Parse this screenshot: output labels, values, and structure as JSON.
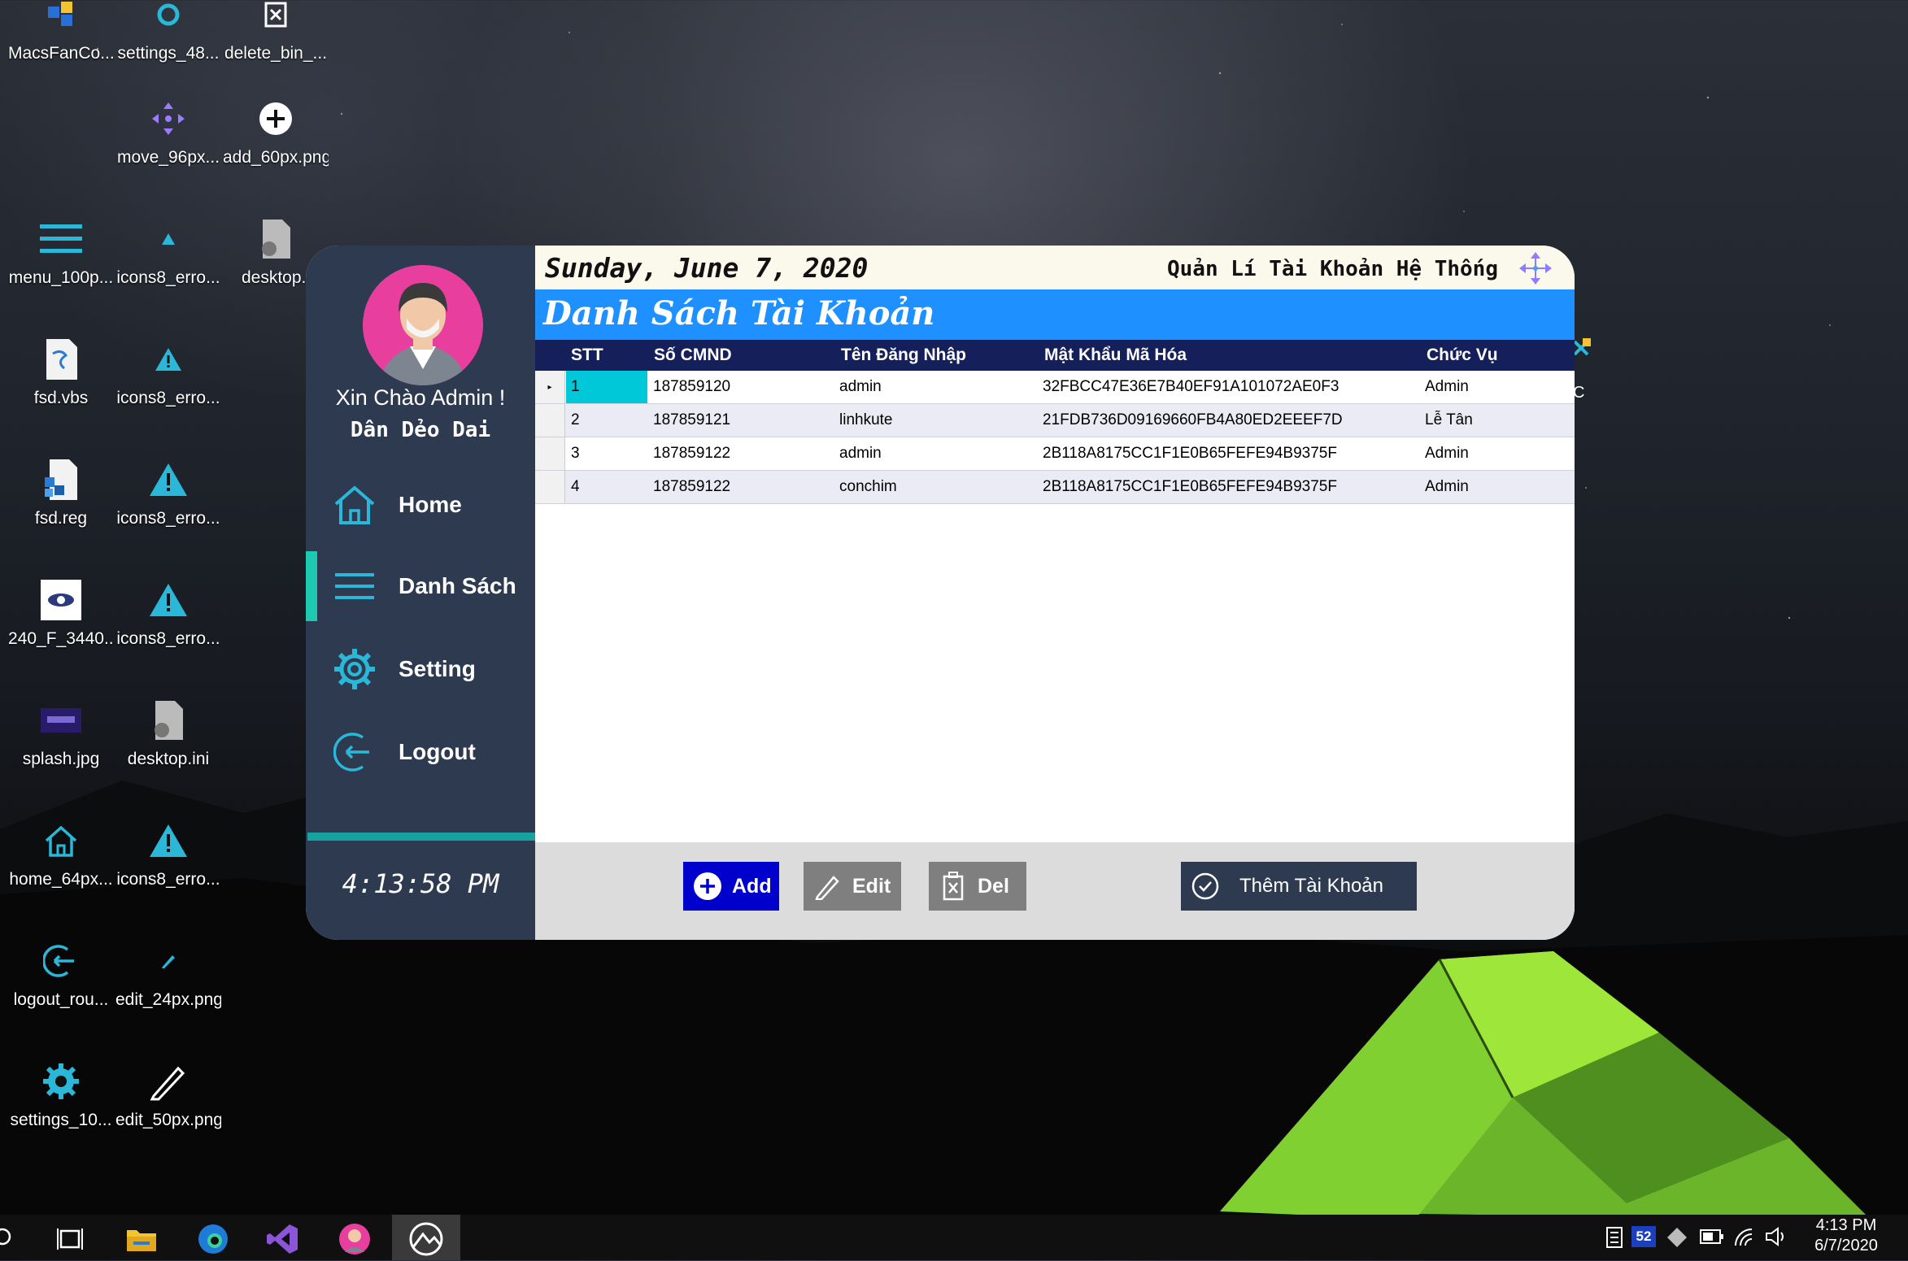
{
  "desktop": {
    "icons": [
      {
        "label": "MacsFanCo...",
        "icon": "app-icon"
      },
      {
        "label": "settings_48...",
        "icon": "gear-icon"
      },
      {
        "label": "delete_bin_...",
        "icon": "delete-icon"
      },
      {
        "label": "move_96px...",
        "icon": "move-icon"
      },
      {
        "label": "add_60px.png",
        "icon": "add-icon"
      },
      {
        "label": "menu_100p...",
        "icon": "menu-icon"
      },
      {
        "label": "icons8_erro...",
        "icon": "warning-icon"
      },
      {
        "label": "desktop.i",
        "icon": "file-gear-icon"
      },
      {
        "label": "fsd.vbs",
        "icon": "script-icon"
      },
      {
        "label": "icons8_erro...",
        "icon": "warning-icon"
      },
      {
        "label": "fsd.reg",
        "icon": "registry-icon"
      },
      {
        "label": "icons8_erro...",
        "icon": "warning-icon"
      },
      {
        "label": "240_F_3440...",
        "icon": "eye-icon"
      },
      {
        "label": "icons8_erro...",
        "icon": "warning-icon"
      },
      {
        "label": "splash.jpg",
        "icon": "image-icon"
      },
      {
        "label": "desktop.ini",
        "icon": "file-gear-icon"
      },
      {
        "label": "home_64px...",
        "icon": "home-icon"
      },
      {
        "label": "icons8_erro...",
        "icon": "warning-icon"
      },
      {
        "label": "logout_rou...",
        "icon": "logout-icon"
      },
      {
        "label": "edit_24px.png",
        "icon": "pencil-icon"
      },
      {
        "label": "settings_10...",
        "icon": "gear-icon"
      },
      {
        "label": "edit_50px.png",
        "icon": "pencil-icon"
      }
    ],
    "right_edge_label": "C"
  },
  "sidebar": {
    "greeting": "Xin Chào Admin !",
    "user_name": "Dân Dẻo Dai",
    "nav": [
      {
        "label": "Home",
        "icon": "home-icon"
      },
      {
        "label": "Danh Sách",
        "icon": "menu-icon",
        "active": true
      },
      {
        "label": "Setting",
        "icon": "gear-icon"
      },
      {
        "label": "Logout",
        "icon": "logout-icon"
      }
    ],
    "clock": "4:13:58 PM"
  },
  "header": {
    "date": "Sunday, June 7, 2020",
    "title": "Quản Lí Tài Khoản Hệ Thống"
  },
  "section_title": "Danh Sách Tài Khoản",
  "table": {
    "columns": [
      "STT",
      "Số CMND",
      "Tên Đăng Nhập",
      "Mật Khẩu Mã Hóa",
      "Chức Vụ"
    ],
    "rows": [
      [
        "1",
        "187859120",
        "admin",
        "32FBCC47E36E7B40EF91A101072AE0F3",
        "Admin"
      ],
      [
        "2",
        "187859121",
        "linhkute",
        "21FDB736D09169660FB4A80ED2EEEF7D",
        "Lễ Tân"
      ],
      [
        "3",
        "187859122",
        "admin",
        "2B118A8175CC1F1E0B65FEFE94B9375F",
        "Admin"
      ],
      [
        "4",
        "187859122",
        "conchim",
        "2B118A8175CC1F1E0B65FEFE94B9375F",
        "Admin"
      ]
    ]
  },
  "buttons": {
    "add": "Add",
    "edit": "Edit",
    "del": "Del",
    "them_tai_khoan": "Thêm Tài Khoản"
  },
  "taskbar": {
    "badge": "52",
    "time": "4:13 PM",
    "date": "6/7/2020"
  },
  "colors": {
    "sidebar": "#2e3a50",
    "accent_teal": "#1fc8b0",
    "heading_blue": "#1e90ff",
    "grid_header": "#15205a",
    "add_button": "#0000cd",
    "edit_del_button": "#7f7f7f",
    "them_button": "#2e3a50"
  }
}
